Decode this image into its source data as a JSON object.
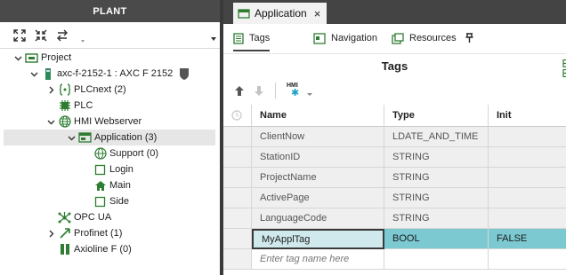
{
  "plant": {
    "title": "PLANT",
    "tree": [
      {
        "label": "Project",
        "icon": "project-icon",
        "expanded": true
      },
      {
        "label": "axc-f-2152-1 : AXC F 2152",
        "icon": "controller-icon",
        "expanded": true
      },
      {
        "label": "PLCnext (2)",
        "icon": "plcnext-icon",
        "expanded": false
      },
      {
        "label": "PLC",
        "icon": "plc-chip-icon"
      },
      {
        "label": "HMI Webserver",
        "icon": "globe-icon",
        "expanded": true
      },
      {
        "label": "Application (3)",
        "icon": "application-icon",
        "expanded": true,
        "selected": true
      },
      {
        "label": "Support (0)",
        "icon": "globe-icon"
      },
      {
        "label": "Login",
        "icon": "page-icon"
      },
      {
        "label": "Main",
        "icon": "home-icon"
      },
      {
        "label": "Side",
        "icon": "page-icon"
      },
      {
        "label": "OPC UA",
        "icon": "opcua-icon"
      },
      {
        "label": "Profinet (1)",
        "icon": "profinet-icon",
        "expanded": false
      },
      {
        "label": "Axioline F (0)",
        "icon": "axioline-icon"
      }
    ]
  },
  "editor": {
    "tab_label": "Application",
    "close_glyph": "×",
    "subtabs": [
      {
        "label": "Tags",
        "icon": "tags-icon",
        "active": true
      },
      {
        "label": "Navigation",
        "icon": "navigation-icon"
      },
      {
        "label": "Resources",
        "icon": "resources-icon"
      }
    ],
    "grid_title": "Tags",
    "hmi_button_label": "HMI",
    "columns": [
      "Name",
      "Type",
      "Init"
    ],
    "rows": [
      {
        "name": "ClientNow",
        "type": "LDATE_AND_TIME",
        "init": ""
      },
      {
        "name": "StationID",
        "type": "STRING",
        "init": ""
      },
      {
        "name": "ProjectName",
        "type": "STRING",
        "init": ""
      },
      {
        "name": "ActivePage",
        "type": "STRING",
        "init": ""
      },
      {
        "name": "LanguageCode",
        "type": "STRING",
        "init": ""
      },
      {
        "name": "MyApplTag",
        "type": "BOOL",
        "init": "FALSE",
        "selected": true
      }
    ],
    "new_row_placeholder": "Enter tag name here"
  },
  "colors": {
    "panel_header": "#4a4a4a",
    "selection": "#7cc9d2",
    "selection_light": "#cfe9ec",
    "accent_green": "#2e8b57"
  }
}
